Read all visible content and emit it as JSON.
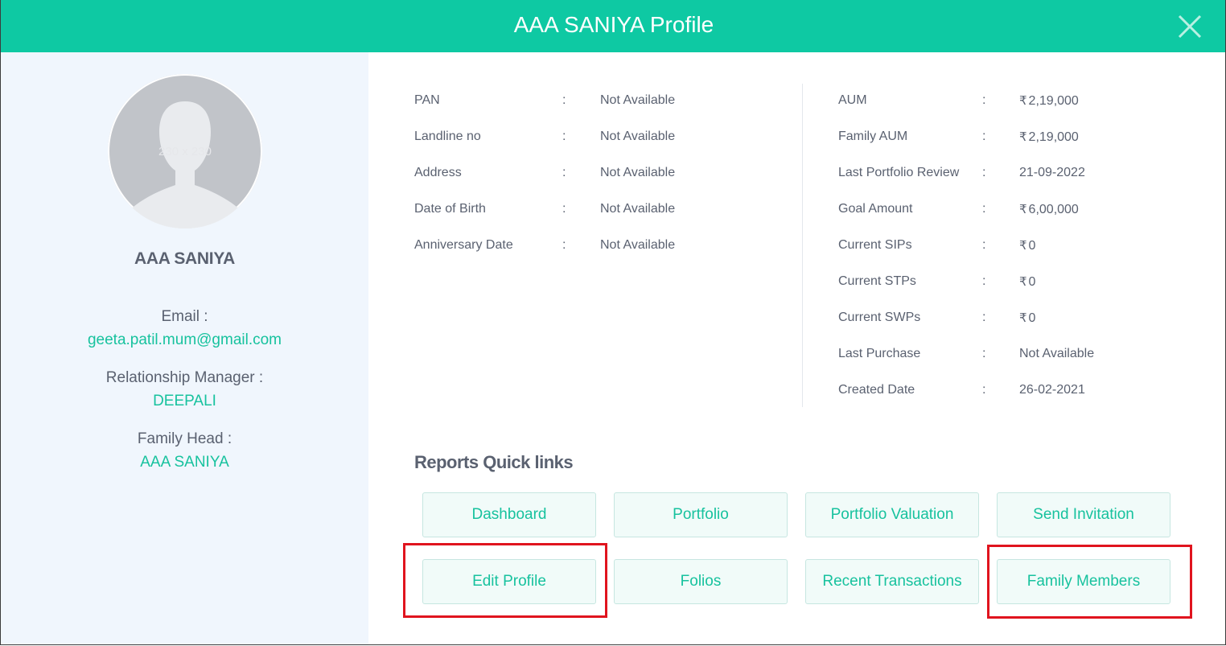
{
  "header": {
    "title": "AAA SANIYA Profile",
    "close_icon": "close-icon",
    "color": "#0ec9a3"
  },
  "sidebar": {
    "avatar_placeholder": "230 x 230",
    "name": "AAA SANIYA",
    "email_label": "Email :",
    "email_value": "geeta.patil.mum@gmail.com",
    "rm_label": "Relationship Manager :",
    "rm_value": "DEEPALI",
    "family_head_label": "Family Head :",
    "family_head_value": "AAA SANIYA"
  },
  "personal_info": [
    {
      "label": "PAN",
      "sep": ":",
      "value": "Not Available"
    },
    {
      "label": "Landline no",
      "sep": ":",
      "value": "Not Available"
    },
    {
      "label": "Address",
      "sep": ":",
      "value": "Not Available"
    },
    {
      "label": "Date of Birth",
      "sep": ":",
      "value": "Not Available"
    },
    {
      "label": "Anniversary Date",
      "sep": ":",
      "value": "Not Available"
    }
  ],
  "financial_info": [
    {
      "label": "AUM",
      "sep": ":",
      "currency": "₹",
      "value": "2,19,000"
    },
    {
      "label": "Family AUM",
      "sep": ":",
      "currency": "₹",
      "value": "2,19,000"
    },
    {
      "label": "Last Portfolio Review",
      "sep": ":",
      "currency": "",
      "value": "21-09-2022"
    },
    {
      "label": "Goal Amount",
      "sep": ":",
      "currency": "₹",
      "value": "6,00,000"
    },
    {
      "label": "Current SIPs",
      "sep": ":",
      "currency": "₹",
      "value": "0"
    },
    {
      "label": "Current STPs",
      "sep": ":",
      "currency": "₹",
      "value": "0"
    },
    {
      "label": "Current SWPs",
      "sep": ":",
      "currency": "₹",
      "value": "0"
    },
    {
      "label": "Last Purchase",
      "sep": ":",
      "currency": "",
      "value": "Not Available"
    },
    {
      "label": "Created Date",
      "sep": ":",
      "currency": "",
      "value": "26-02-2021"
    }
  ],
  "quick_links": {
    "title": "Reports Quick links",
    "buttons": [
      "Dashboard",
      "Portfolio",
      "Portfolio Valuation",
      "Send Invitation",
      "Edit Profile",
      "Folios",
      "Recent Transactions",
      "Family Members"
    ],
    "highlighted": [
      "Edit Profile",
      "Family Members"
    ],
    "highlight_color": "#e0141e"
  }
}
